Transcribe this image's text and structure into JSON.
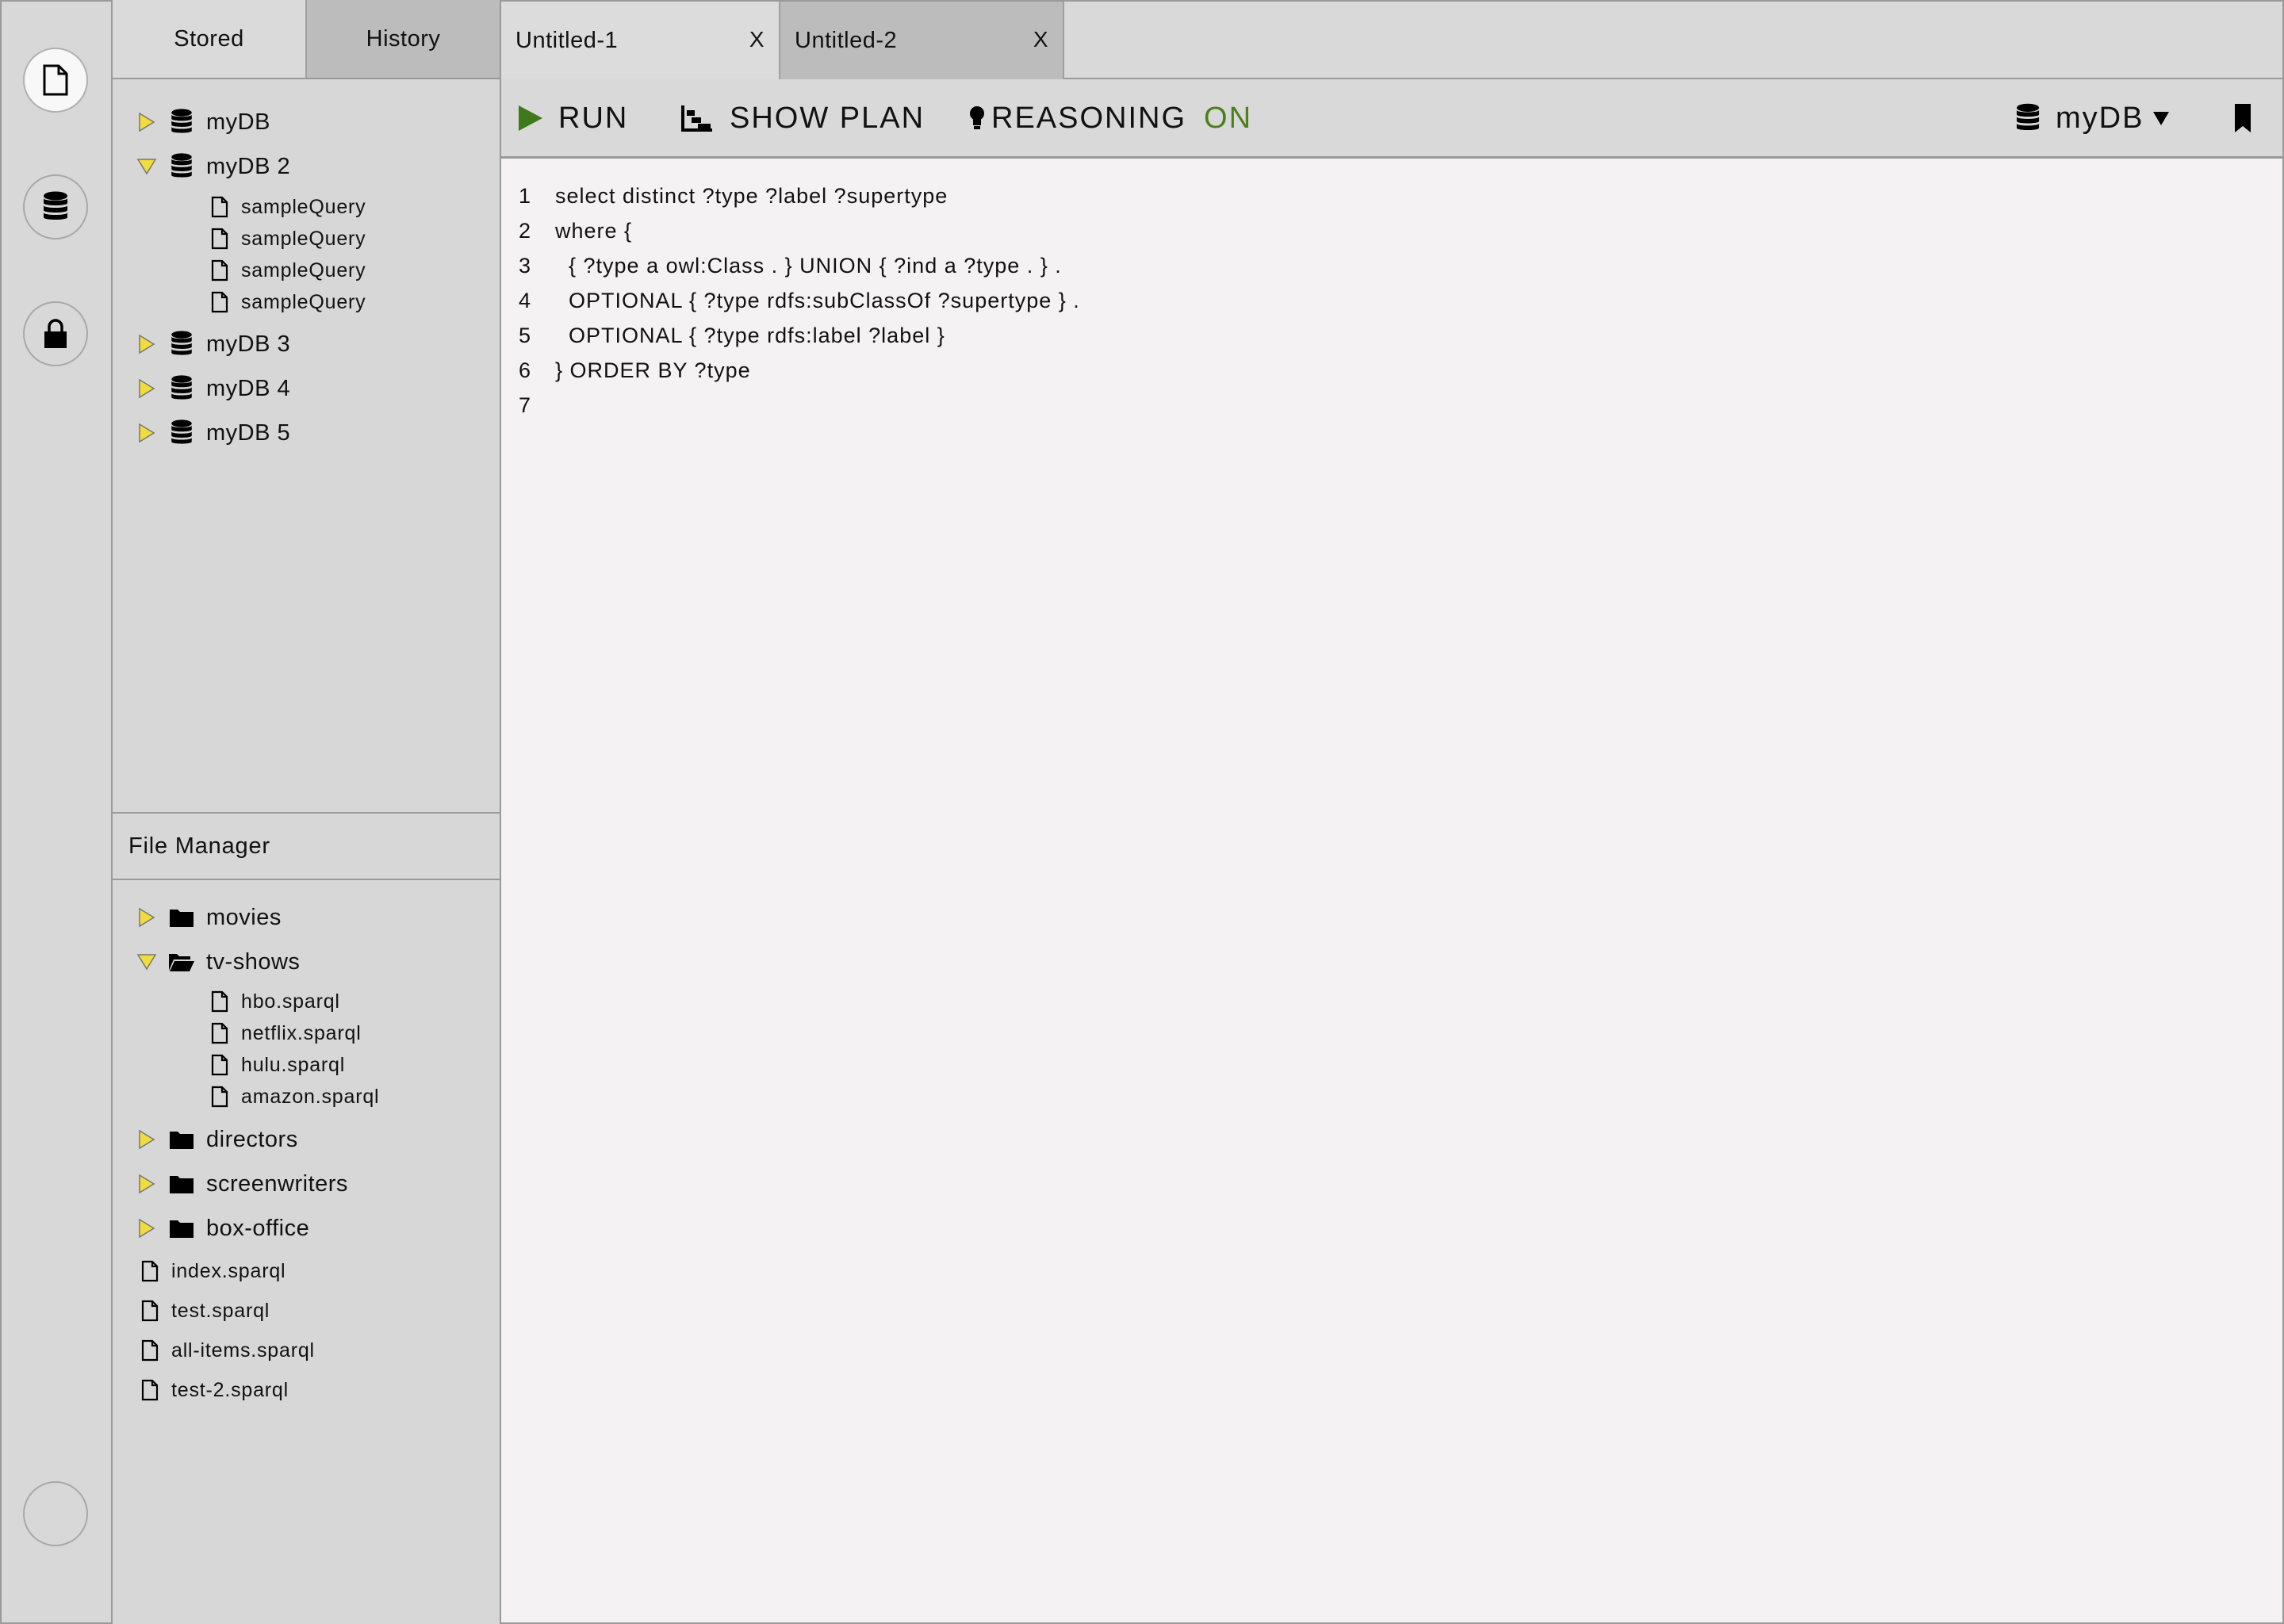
{
  "sidebar_tabs": {
    "stored": "Stored",
    "history": "History"
  },
  "stored_tree": [
    {
      "label": "myDB",
      "expanded": false
    },
    {
      "label": "myDB 2",
      "expanded": true,
      "children": [
        "sampleQuery",
        "sampleQuery",
        "sampleQuery",
        "sampleQuery"
      ]
    },
    {
      "label": "myDB 3",
      "expanded": false
    },
    {
      "label": "myDB 4",
      "expanded": false
    },
    {
      "label": "myDB 5",
      "expanded": false
    }
  ],
  "file_manager": {
    "title": "File Manager",
    "folders": [
      {
        "label": "movies",
        "expanded": false
      },
      {
        "label": "tv-shows",
        "expanded": true,
        "children": [
          "hbo.sparql",
          "netflix.sparql",
          "hulu.sparql",
          "amazon.sparql"
        ]
      },
      {
        "label": "directors",
        "expanded": false
      },
      {
        "label": "screenwriters",
        "expanded": false
      },
      {
        "label": "box-office",
        "expanded": false
      }
    ],
    "files": [
      "index.sparql",
      "test.sparql",
      "all-items.sparql",
      "test-2.sparql"
    ]
  },
  "editor_tabs": [
    {
      "label": "Untitled-1",
      "close": "X"
    },
    {
      "label": "Untitled-2",
      "close": "X"
    }
  ],
  "toolbar": {
    "run_label": "RUN",
    "show_plan_label": "SHOW PLAN",
    "reasoning_label": "REASONING",
    "reasoning_state": "ON",
    "database_selected": "myDB"
  },
  "editor": {
    "lines": [
      {
        "num": "1",
        "code": "select distinct ?type ?label ?supertype"
      },
      {
        "num": "2",
        "code": "where {"
      },
      {
        "num": "3",
        "code": "  { ?type a owl:Class . } UNION { ?ind a ?type . } ."
      },
      {
        "num": "4",
        "code": "  OPTIONAL { ?type rdfs:subClassOf ?supertype } ."
      },
      {
        "num": "5",
        "code": "  OPTIONAL { ?type rdfs:label ?label }"
      },
      {
        "num": "6",
        "code": "} ORDER BY ?type"
      },
      {
        "num": "7",
        "code": ""
      }
    ]
  },
  "colors": {
    "tree_triangle": "#f0dc3c",
    "run_triangle": "#3e7a1a",
    "reasoning_on": "#4a7f1c",
    "active_tab": "#bcbcbc",
    "editor_bg": "#f4f2f3"
  },
  "icons": {
    "rail": [
      "document-icon",
      "database-icon",
      "lock-icon",
      "circle-icon"
    ],
    "toolbar": [
      "play-icon",
      "plan-icon",
      "lightbulb-icon",
      "database-icon",
      "chevron-down-icon",
      "bookmark-icon"
    ]
  }
}
